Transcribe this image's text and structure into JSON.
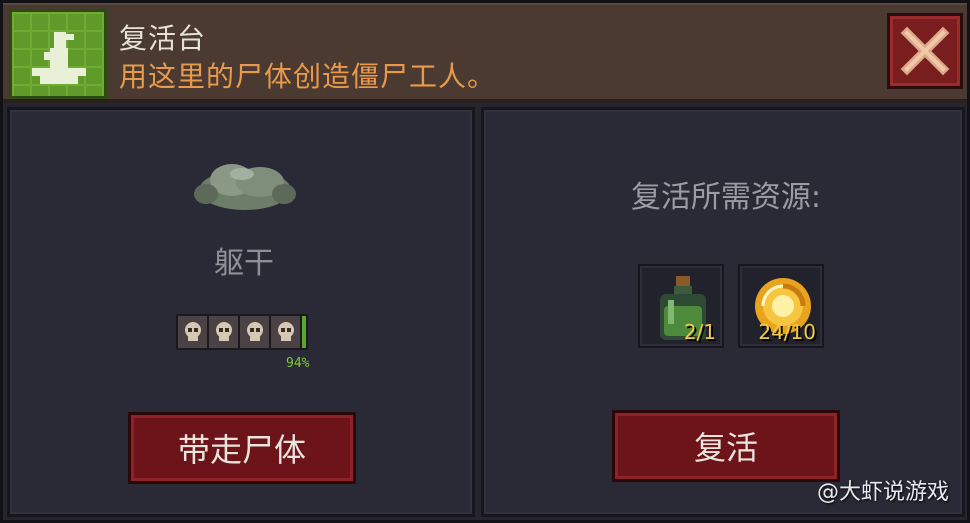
{
  "header": {
    "title": "复活台",
    "subtitle": "用这里的尸体创造僵尸工人。",
    "icon": "altar-icon",
    "close_icon": "close-icon"
  },
  "left_panel": {
    "body_icon": "corpse-icon",
    "body_name": "躯干",
    "quality_skulls": 4,
    "quality_percent": "94%",
    "quality_fraction": 0.94,
    "take_button": "带走尸体"
  },
  "right_panel": {
    "resources_label": "复活所需资源:",
    "resources": [
      {
        "icon": "potion-bottle-icon",
        "count": "2/1"
      },
      {
        "icon": "gold-orb-icon",
        "count": "24/10"
      }
    ],
    "revive_button": "复活"
  },
  "watermark": "@大虾说游戏",
  "colors": {
    "header_bg": "#4a3a32",
    "subtitle": "#e89a4a",
    "button_bg": "#6c1419",
    "panel_bg": "#2a2a36",
    "progress": "#5aa82a",
    "resource_count": "#f0c84a"
  }
}
